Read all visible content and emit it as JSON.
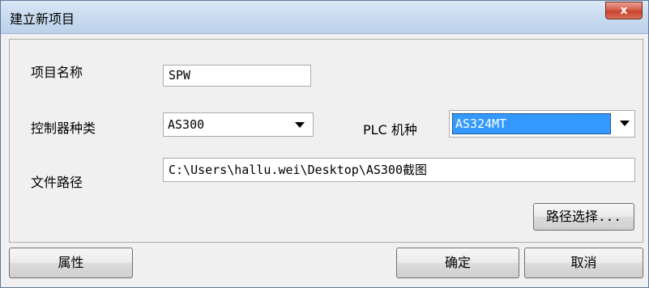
{
  "window": {
    "title": "建立新项目",
    "close_glyph": "x"
  },
  "form": {
    "project_name_label": "项目名称",
    "project_name_value": "SPW",
    "controller_type_label": "控制器种类",
    "controller_type_value": "AS300",
    "plc_model_label": "PLC 机种",
    "plc_model_value": "AS324MT",
    "file_path_label": "文件路径",
    "file_path_value": "C:\\Users\\hallu.wei\\Desktop\\AS300截图",
    "browse_path_label": "路径选择..."
  },
  "footer": {
    "properties_label": "属性",
    "ok_label": "确定",
    "cancel_label": "取消"
  },
  "icons": {
    "close": "close-icon",
    "dropdown": "chevron-down-icon"
  }
}
